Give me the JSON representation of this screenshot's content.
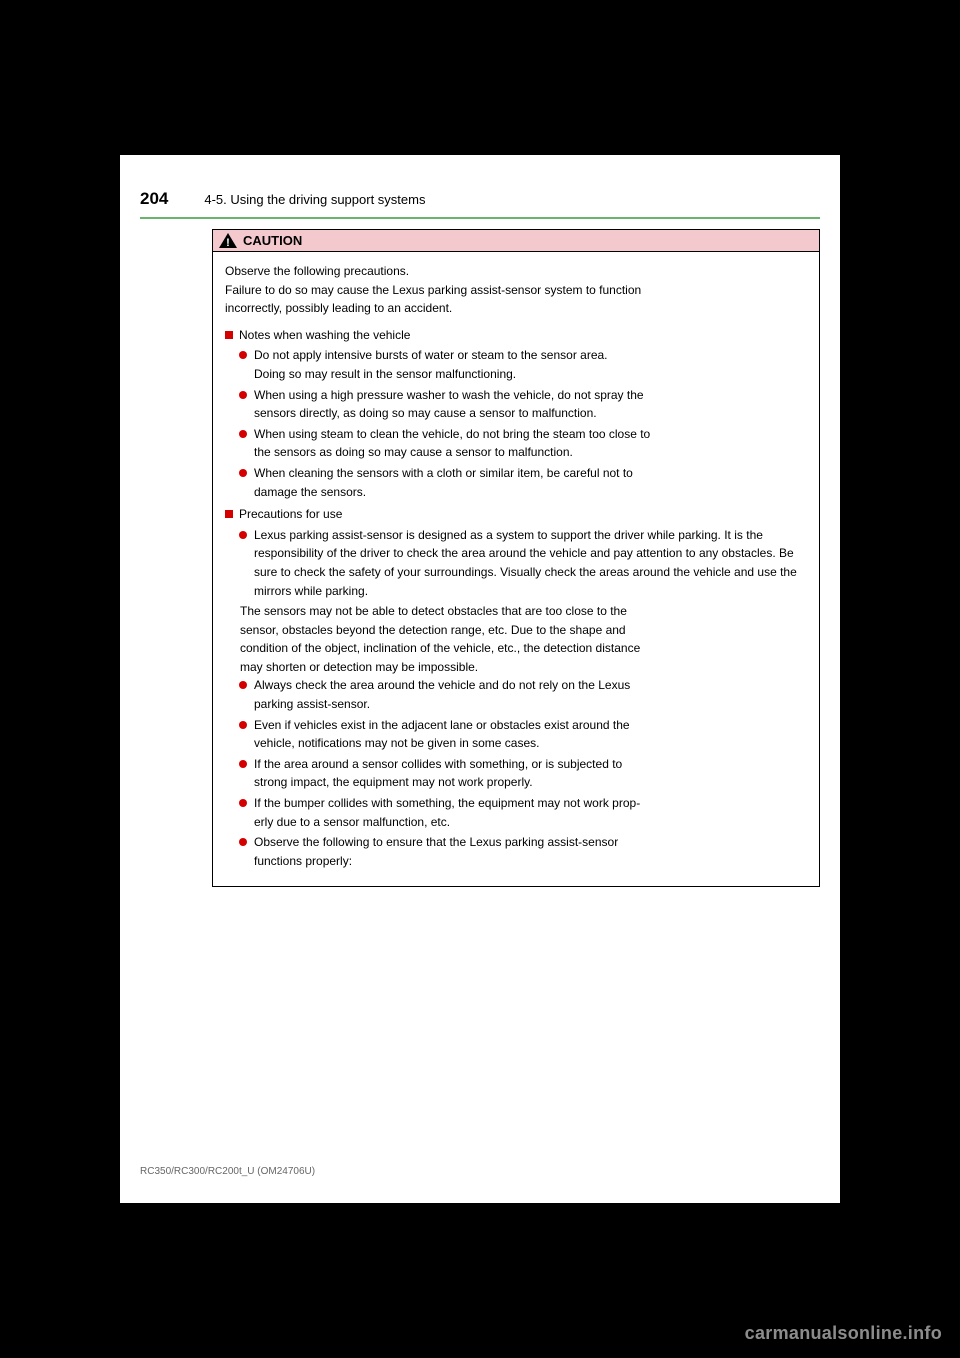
{
  "header": {
    "page_number": "204",
    "breadcrumb": "4-5. Using the driving support systems"
  },
  "caution": {
    "label": "CAUTION",
    "intro": "Observe the following precautions.\nFailure to do so may cause the Lexus parking assist-sensor system to function\nincorrectly, possibly leading to an accident.",
    "sections": [
      {
        "title": "Notes when washing the vehicle",
        "bullets": [
          "Do not apply intensive bursts of water or steam to the sensor area.\nDoing so may result in the sensor malfunctioning.",
          "When using a high pressure washer to wash the vehicle, do not spray the\nsensors directly, as doing so may cause a sensor to malfunction.",
          "When using steam to clean the vehicle, do not bring the steam too close to\nthe sensors as doing so may cause a sensor to malfunction.",
          "When cleaning the sensors with a cloth or similar item, be careful not to\ndamage the sensors."
        ]
      },
      {
        "title": "Precautions for use",
        "bullets": [
          "Lexus parking assist-sensor is designed as a system to support the driver while parking. It is the responsibility of the driver to check the area around the vehicle and pay attention to any obstacles. Be sure to check the safety of your surroundings. Visually check the areas around the vehicle and use the mirrors while parking."
        ],
        "sub_paragraph": "The sensors may not be able to detect obstacles that are too close to the\nsensor, obstacles beyond the detection range, etc. Due to the shape and\ncondition of the object, inclination of the vehicle, etc., the detection distance\nmay shorten or detection may be impossible.",
        "bullets2": [
          "Always check the area around the vehicle and do not rely on the Lexus\nparking assist-sensor.",
          "Even if vehicles exist in the adjacent lane or obstacles exist around the\nvehicle, notifications may not be given in some cases.",
          "If the area around a sensor collides with something, or is subjected to\nstrong impact, the equipment may not work properly.",
          "If the bumper collides with something, the equipment may not work prop-\nerly due to a sensor malfunction, etc.",
          "Observe the following to ensure that the Lexus parking assist-sensor\nfunctions properly:"
        ]
      }
    ]
  },
  "footer": {
    "code": "RC350/RC300/RC200t_U (OM24706U)"
  },
  "watermark": "carmanualsonline.info"
}
